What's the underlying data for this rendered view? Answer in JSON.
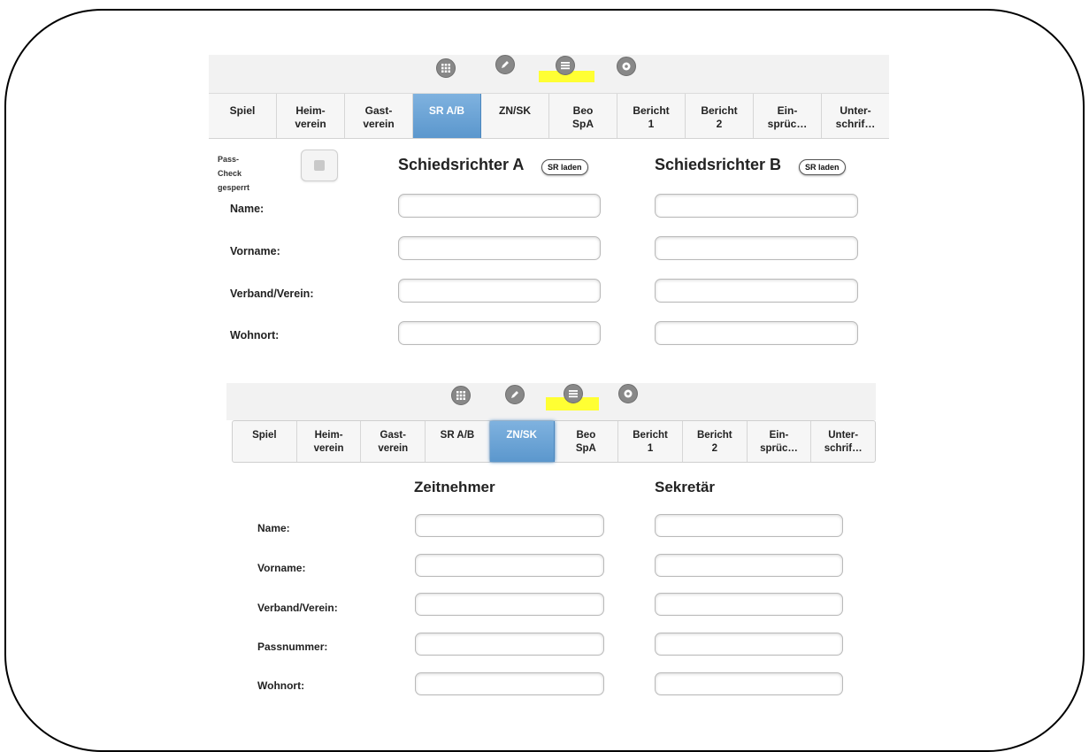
{
  "panel_a": {
    "tabs": [
      {
        "label": "Spiel"
      },
      {
        "label": "Heim-\nverein"
      },
      {
        "label": "Gast-\nverein"
      },
      {
        "label": "SR A/B",
        "active": true
      },
      {
        "label": "ZN/SK"
      },
      {
        "label": "Beo\nSpA"
      },
      {
        "label": "Bericht\n1"
      },
      {
        "label": "Bericht\n2"
      },
      {
        "label": "Ein-\nsprüc…"
      },
      {
        "label": "Unter-\nschrif…"
      }
    ],
    "pass_check_label": "Pass-\nCheck\ngesperrt",
    "heading_a": "Schiedsrichter A",
    "heading_b": "Schiedsrichter B",
    "sr_laden_label": "SR laden",
    "labels": {
      "name": "Name:",
      "vorname": "Vorname:",
      "verband": "Verband/Verein:",
      "wohnort": "Wohnort:"
    }
  },
  "panel_b": {
    "tabs": [
      {
        "label": "Spiel"
      },
      {
        "label": "Heim-\nverein"
      },
      {
        "label": "Gast-\nverein"
      },
      {
        "label": "SR A/B"
      },
      {
        "label": "ZN/SK",
        "active": true
      },
      {
        "label": "Beo\nSpA"
      },
      {
        "label": "Bericht\n1"
      },
      {
        "label": "Bericht\n2"
      },
      {
        "label": "Ein-\nsprüc…"
      },
      {
        "label": "Unter-\nschrif…"
      }
    ],
    "heading_a": "Zeitnehmer",
    "heading_b": "Sekretär",
    "labels": {
      "name": "Name:",
      "vorname": "Vorname:",
      "verband": "Verband/Verein:",
      "passnummer": "Passnummer:",
      "wohnort": "Wohnort:"
    }
  },
  "icons": [
    "grid-icon",
    "pencil-icon",
    "list-icon",
    "gear-icon"
  ],
  "colors": {
    "active_tab": "#5b97cd",
    "highlight": "#ffff33"
  }
}
